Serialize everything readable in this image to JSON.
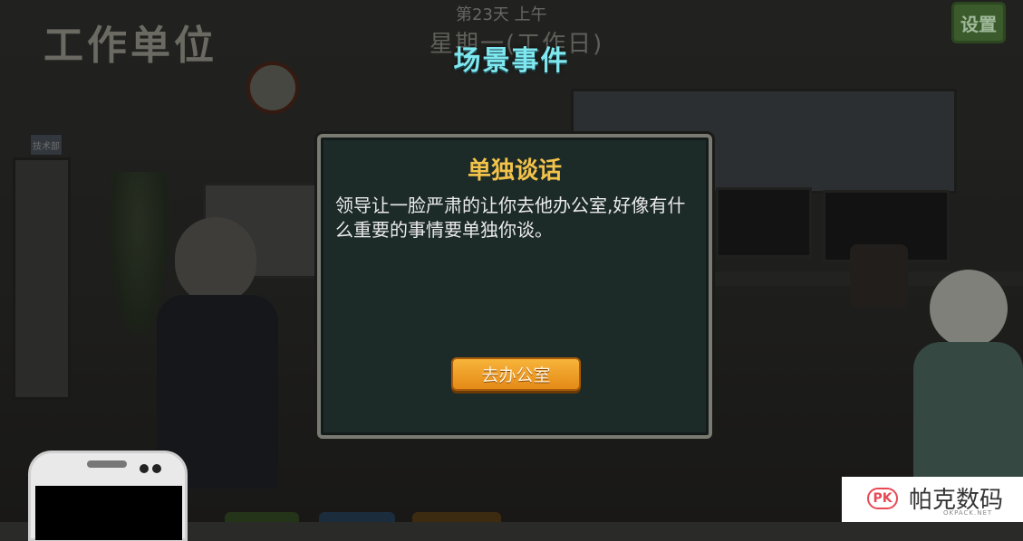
{
  "location_title": "工作单位",
  "day_label": "第23天 上午",
  "weekday_label": "星期一(工作日)",
  "settings_label": "设置",
  "event_header": "场景事件",
  "dialog": {
    "title": "单独谈话",
    "text": "领导让一脸严肃的让你去他办公室,好像有什么重要的事情要单独你谈。",
    "button_label": "去办公室"
  },
  "door_sign": "技术部",
  "watermark": {
    "logo": "PK",
    "text": "帕克数码",
    "sub": "OKPACK.NET"
  },
  "colors": {
    "event_header": "#7ee7ef",
    "dialog_title": "#f2c24a",
    "button": "#f2a02a",
    "settings_button": "#3b5b2c"
  }
}
